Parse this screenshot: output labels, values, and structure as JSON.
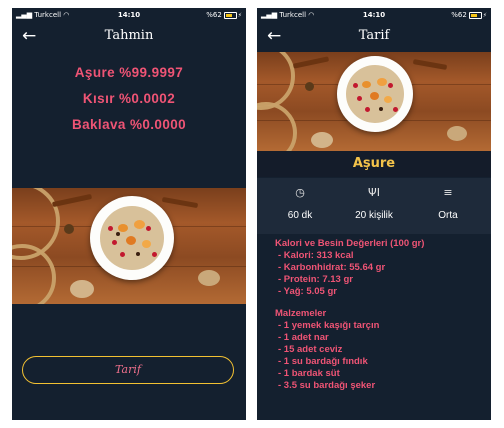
{
  "status_bar": {
    "carrier": "Turkcell",
    "time": "14:10",
    "battery": "%62"
  },
  "prediction_screen": {
    "title": "Tahmin",
    "predictions": [
      "Aşure %99.9997",
      "Kısır %0.0002",
      "Baklava %0.0000"
    ],
    "recipe_button_label": "Tarif"
  },
  "recipe_screen": {
    "title": "Tarif",
    "dish_name": "Aşure",
    "info": [
      {
        "icon": "clock-icon",
        "value": "60 dk"
      },
      {
        "icon": "cutlery-icon",
        "value": "20 kişilik"
      },
      {
        "icon": "difficulty-icon",
        "value": "Orta"
      }
    ],
    "nutrition_heading": "Kalori ve Besin Değerleri (100 gr)",
    "nutrition": [
      "- Kalori: 313 kcal",
      "- Karbonhidrat: 55.64 gr",
      "- Protein: 7.13 gr",
      "- Yağ: 5.05 gr"
    ],
    "ingredients_heading": "Malzemeler",
    "ingredients": [
      "- 1 yemek kaşığı tarçın",
      "- 1 adet nar",
      "- 15 adet ceviz",
      "- 1 su bardağı fındık",
      "- 1 bardak süt",
      "- 3.5 su bardağı şeker"
    ]
  },
  "colors": {
    "background": "#14202f",
    "accent_pink": "#ef5475",
    "accent_yellow": "#f3c132"
  }
}
